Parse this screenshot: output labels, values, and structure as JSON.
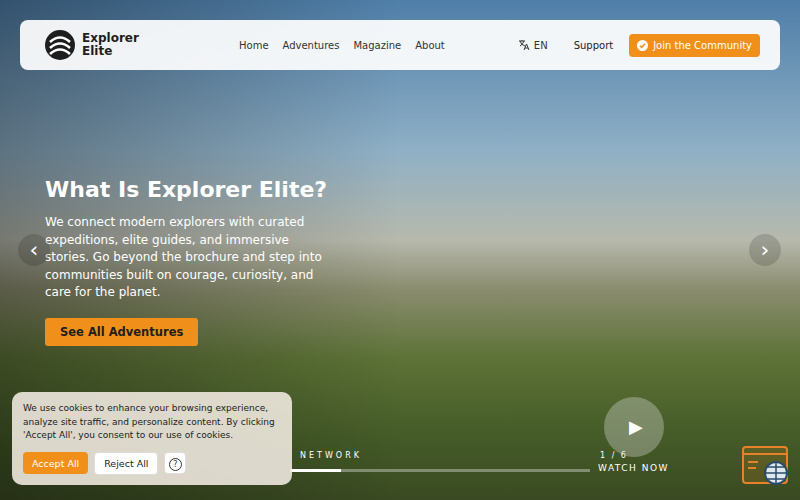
{
  "nav": {
    "logo": [
      "Explorer",
      "Elite"
    ],
    "links": [
      "Home",
      "Adventures",
      "Magazine",
      "About"
    ],
    "language": "EN",
    "support": "Support",
    "cta": "Join the Community"
  },
  "hero": {
    "title": "What Is Explorer Elite?",
    "text": "We connect modern explorers with curated expeditions, elite guides, and immersive stories. Go beyond the brochure and step into communities built on courage, curiosity, and care for the planet.",
    "button": "See All Adventures",
    "prev": "‹",
    "next": "›"
  },
  "slider": {
    "label": "NETWORK",
    "counter": "1 / 6",
    "level": 0.17
  },
  "video": {
    "play": "▶",
    "label": "WATCH NOW"
  },
  "cookie": {
    "text": "We use cookies to enhance your browsing experience, analyze site traffic, and personalize content. By clicking 'Accept All', you consent to our use of cookies.",
    "accept": "Accept All",
    "reject": "Reject All",
    "help": "?"
  }
}
